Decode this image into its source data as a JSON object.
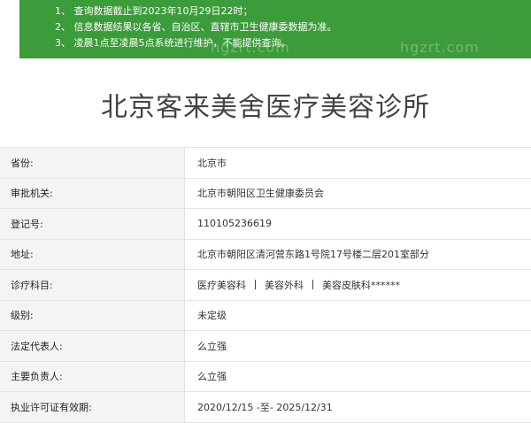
{
  "notice": {
    "lines": [
      "1、 查询数据截止到2023年10月29日22时；",
      "2、 信息数据结果以各省、自治区、直辖市卫生健康委数据为准。",
      "3、 凌晨1点至凌晨5点系统进行维护，不能提供查询。"
    ],
    "watermark": "hgzrt.com"
  },
  "title": "北京客来美舍医疗美容诊所",
  "rows": [
    {
      "label": "省份:",
      "value": "北京市"
    },
    {
      "label": "审批机关:",
      "value": "北京市朝阳区卫生健康委员会"
    },
    {
      "label": "登记号:",
      "value": "110105236619"
    },
    {
      "label": "地址:",
      "value": "北京市朝阳区清河营东路1号院17号楼二层201室部分"
    },
    {
      "label": "诊疗科目:",
      "values": [
        "医疗美容科",
        "美容外科",
        "美容皮肤科******"
      ]
    },
    {
      "label": "级别:",
      "value": "未定级"
    },
    {
      "label": "法定代表人:",
      "value": "么立强"
    },
    {
      "label": "主要负责人:",
      "value": "么立强"
    },
    {
      "label": "执业许可证有效期:",
      "value": "2020/12/15 -至- 2025/12/31"
    }
  ]
}
